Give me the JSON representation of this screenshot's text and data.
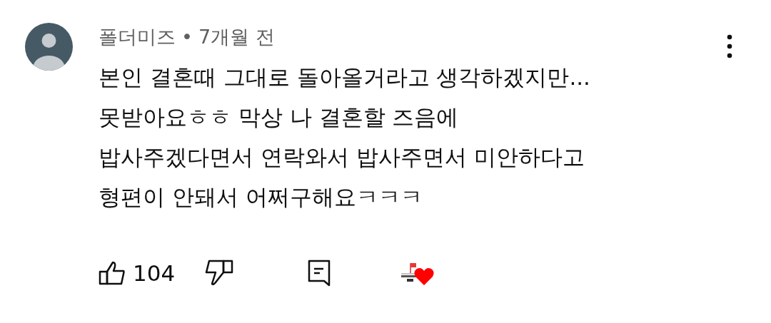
{
  "comment": {
    "author": "폴더미즈",
    "separator": "•",
    "time": "7개월 전",
    "lines": [
      "본인 결혼때 그대로 돌아올거라고 생각하겠지만...",
      "못받아요ㅎㅎ 막상 나 결혼할 즈음에",
      "밥사주겠다면서 연락와서 밥사주면서 미안하다고",
      "형편이 안돼서 어쩌구해요ㅋㅋㅋ"
    ],
    "likes": "104",
    "creator_hearted": true
  }
}
